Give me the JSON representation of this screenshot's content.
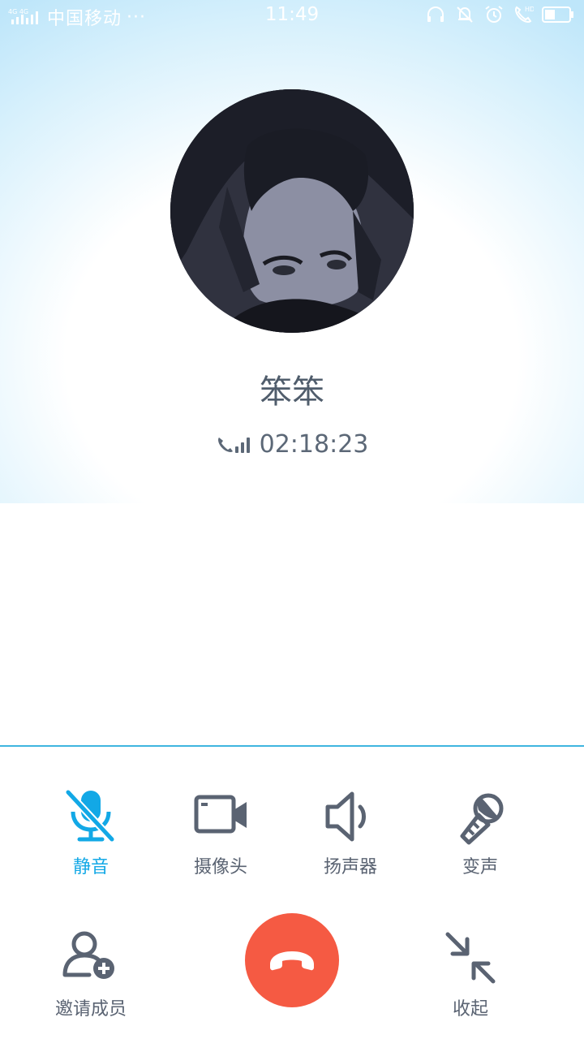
{
  "status_bar": {
    "carrier": "中国移动",
    "more": "···",
    "time": "11:49"
  },
  "contact": {
    "name": "笨笨",
    "duration": "02:18:23"
  },
  "controls": {
    "mute": "静音",
    "camera": "摄像头",
    "speaker": "扬声器",
    "voice_change": "变声",
    "invite": "邀请成员",
    "collapse": "收起"
  },
  "colors": {
    "accent_active": "#12a8e6",
    "hangup_red": "#f55a43",
    "divider": "#3fb5df",
    "icon_gray": "#5a6372"
  }
}
